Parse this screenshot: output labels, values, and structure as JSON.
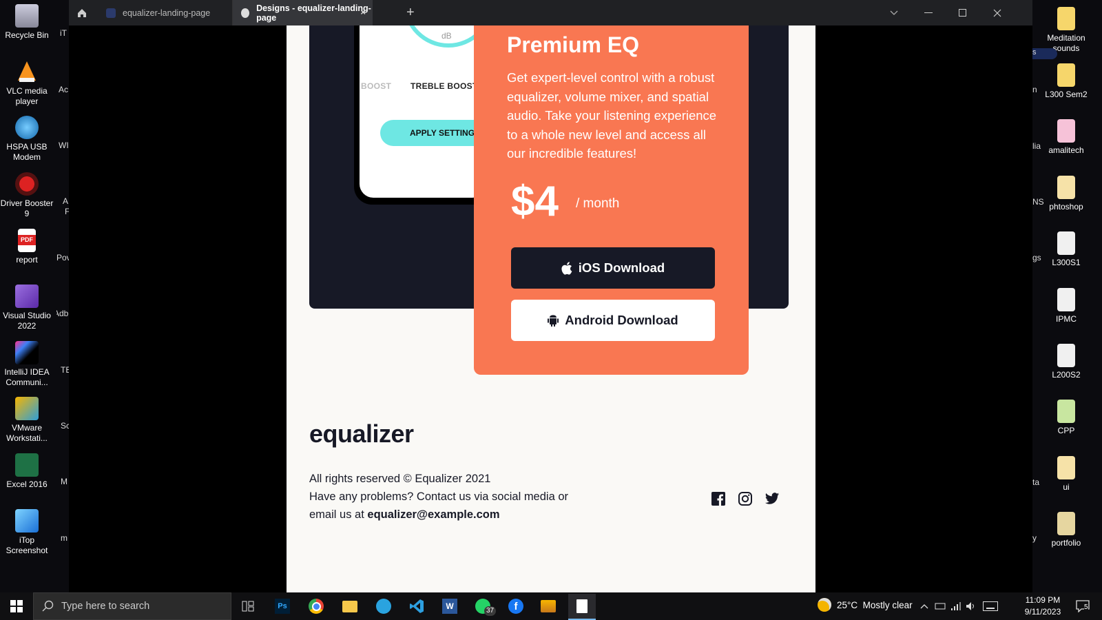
{
  "desktop": {
    "left_icons": [
      {
        "label": "Recycle Bin"
      },
      {
        "label": "VLC media player"
      },
      {
        "label": "HSPA USB Modem"
      },
      {
        "label": "Driver Booster 9"
      },
      {
        "label": "report"
      },
      {
        "label": "Visual Studio 2022"
      },
      {
        "label": "IntelliJ IDEA Communi..."
      },
      {
        "label": "VMware Workstati..."
      },
      {
        "label": "Excel 2016"
      },
      {
        "label": "iTop Screenshot"
      }
    ],
    "left_partial": [
      "iT",
      "Ac",
      "WI",
      "A",
      "F",
      "Pov",
      "Adb",
      "TE",
      "Sc",
      "M",
      "m"
    ],
    "right_icons": [
      {
        "label": "Meditation sounds"
      },
      {
        "label": "L300 Sem2"
      },
      {
        "label": "amalitech"
      },
      {
        "label": "phtoshop"
      },
      {
        "label": "L300S1"
      },
      {
        "label": "IPMC"
      },
      {
        "label": "L200S2"
      },
      {
        "label": "CPP"
      },
      {
        "label": "ui"
      },
      {
        "label": "portfolio"
      }
    ],
    "right_partial": [
      "s",
      "n",
      "lia",
      "NS",
      "gs",
      "ta",
      "y"
    ]
  },
  "browser": {
    "tabs": [
      {
        "label": "equalizer-landing-page",
        "active": false
      },
      {
        "label": "Designs - equalizer-landing-page",
        "active": true
      }
    ],
    "new_tab": "+",
    "close_tab": "×"
  },
  "page": {
    "phone": {
      "unit": "dB",
      "boost_left": "BOOST",
      "boost_right": "TREBLE BOOST",
      "apply": "APPLY SETTINGS"
    },
    "card": {
      "title": "Premium EQ",
      "description": "Get expert-level control with a robust equalizer, volume mixer, and spatial audio. Take your listening experience to a whole new level and access all our incredible features!",
      "price": "$4",
      "period": "/ month",
      "ios_button": "iOS Download",
      "android_button": "Android Download"
    },
    "footer": {
      "logo": "equalizer",
      "line1": "All rights reserved © Equalizer 2021",
      "line2": "Have any problems? Contact us via social media or email us at",
      "email": "equalizer@example.com",
      "social": [
        "facebook-icon",
        "instagram-icon",
        "twitter-icon"
      ]
    }
  },
  "taskbar": {
    "search_placeholder": "Type here to search",
    "whatsapp_badge": "37",
    "weather": "25°C  Mostly clear",
    "time": "11:09 PM",
    "date": "9/11/2023",
    "notifications": "5"
  },
  "colors": {
    "accent": "#f97752",
    "dark": "#171926",
    "cyan": "#6ee7e3"
  }
}
